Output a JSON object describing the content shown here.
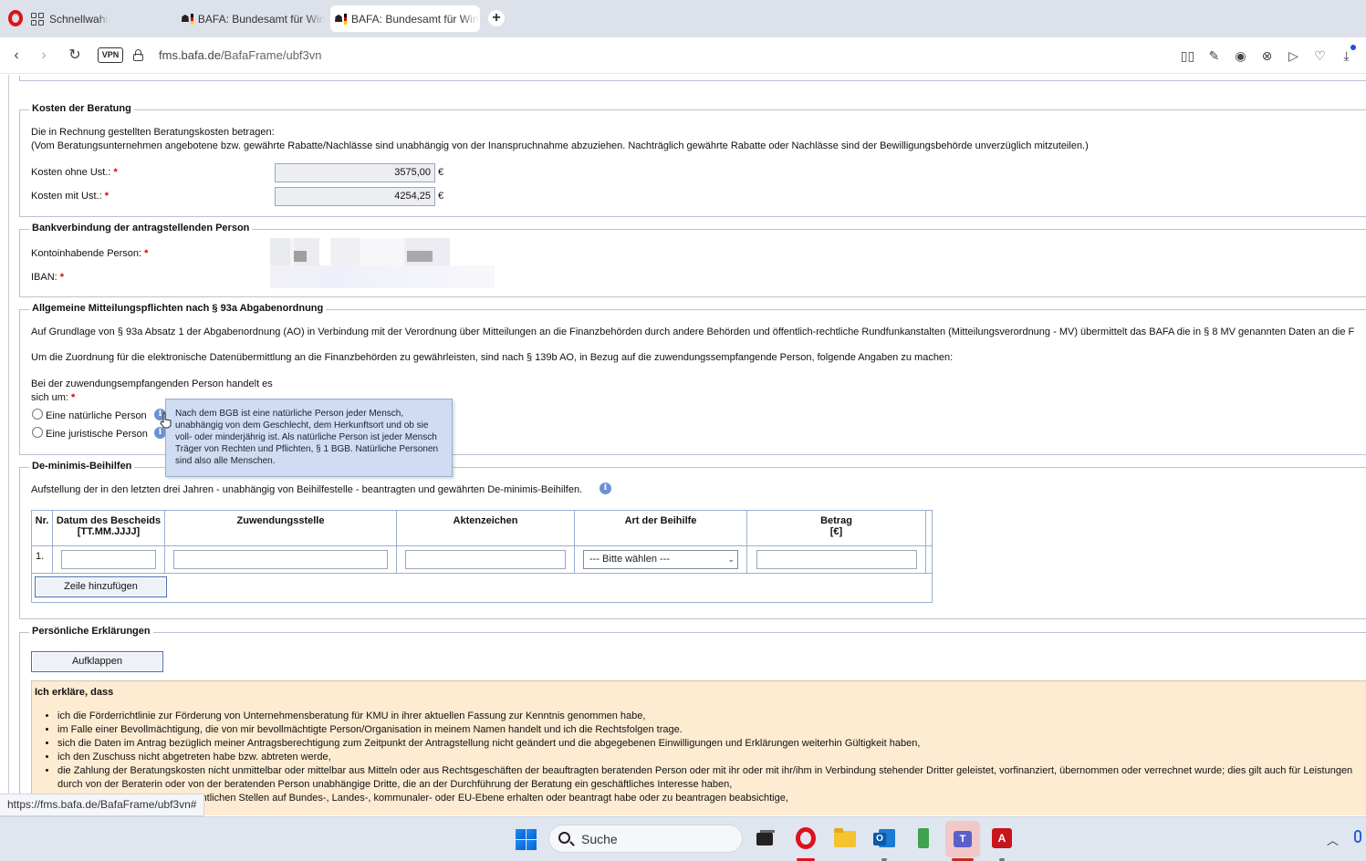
{
  "browser": {
    "tabs": [
      {
        "label": "Schnellwahl",
        "icon": "grid-icon"
      },
      {
        "label": "BAFA: Bundesamt für Wirt",
        "icon": "bafa-flag-icon"
      },
      {
        "label": "BAFA: Bundesamt für Wirt",
        "icon": "bafa-flag-icon",
        "active": true
      }
    ],
    "new_tab": "+",
    "vpn": "VPN",
    "url_host": "fms.bafa.de",
    "url_path": "/BafaFrame/ubf3vn"
  },
  "kosten": {
    "legend": "Kosten der Beratung",
    "intro1": "Die in Rechnung gestellten Beratungskosten betragen:",
    "intro2": "(Vom Beratungsunternehmen angebotene bzw. gewährte Rabatte/Nachlässe sind unabhängig von der Inanspruchnahme abzuziehen. Nachträglich gewährte Rabatte oder Nachlässe sind der Bewilligungsbehörde unverzüglich mitzuteilen.)",
    "ohne_label": "Kosten ohne Ust.:",
    "ohne_value": "3575,00",
    "mit_label": "Kosten mit Ust.:",
    "mit_value": "4254,25",
    "currency": "€",
    "required": "*"
  },
  "bank": {
    "legend": "Bankverbindung der antragstellenden Person",
    "holder_label": "Kontoinhabende Person:",
    "iban_label": "IBAN:"
  },
  "mitteilung": {
    "legend": "Allgemeine Mitteilungspflichten nach § 93a Abgabenordnung",
    "p1": "Auf Grundlage von § 93a Absatz 1 der Abgabenordnung (AO) in Verbindung mit der Verordnung über Mitteilungen an die Finanzbehörden durch andere Behörden und öffentlich-rechtliche Rundfunkanstalten (Mitteilungsverordnung - MV) übermittelt das BAFA die in § 8 MV genannten Daten an die F",
    "p2": "Um die Zuordnung für die elektronische Datenübermittlung an die Finanzbehörden zu gewährleisten, sind nach § 139b AO, in Bezug auf die zuwendungssempfangende Person, folgende Angaben zu machen:",
    "q1": "Bei der zuwendungsempfangenden Person handelt es",
    "q2": "sich um:",
    "opt_natural": "Eine natürliche Person",
    "opt_legal": "Eine juristische Person",
    "info": "i",
    "tooltip": [
      "Nach dem BGB ist eine natürliche Person jeder Mensch,",
      "unabhängig von dem Geschlecht, dem Herkunftsort und ob sie",
      "voll- oder minderjährig ist. Als natürliche Person ist jeder Mensch",
      "Träger von Rechten und Pflichten, § 1 BGB. Natürliche Personen",
      "sind also alle Menschen."
    ]
  },
  "deminimis": {
    "legend": "De-minimis-Beihilfen",
    "intro": "Aufstellung der in den letzten drei Jahren - unabhängig von Beihilfestelle - beantragten und gewährten De-minimis-Beihilfen.",
    "headers": {
      "nr": "Nr.",
      "datum1": "Datum des Bescheids",
      "datum2": "[TT.MM.JJJJ]",
      "stelle": "Zuwendungsstelle",
      "akten": "Aktenzeichen",
      "art": "Art der Beihilfe",
      "betrag1": "Betrag",
      "betrag2": "[€]"
    },
    "row_nr": "1.",
    "select_value": "--- Bitte wählen ---",
    "add_row": "Zeile hinzufügen"
  },
  "erklaerung": {
    "legend": "Persönliche Erklärungen",
    "toggle": "Aufklappen",
    "head": "Ich erkläre, dass",
    "items": [
      "ich die Förderrichtlinie zur Förderung von Unternehmensberatung für KMU in ihrer aktuellen Fassung zur Kenntnis genommen habe,",
      "im Falle einer Bevollmächtigung, die von mir bevollmächtigte Person/Organisation in meinem Namen handelt und ich die Rechtsfolgen trage.",
      "sich die Daten im Antrag bezüglich meiner Antragsberechtigung zum Zeitpunkt der Antragstellung nicht geändert und die abgegebenen Einwilligungen und Erklärungen weiterhin Gültigkeit haben,",
      "ich den Zuschuss nicht abgetreten habe bzw. abtreten werde,",
      "die Zahlung der Beratungskosten nicht unmittelbar oder mittelbar aus Mitteln oder aus Rechtsgeschäften der beauftragten beratenden Person oder mit ihr oder mit ihr/ihm in Verbindung stehender Dritter geleistet, vorfinanziert, übernommen oder verrechnet wurde; dies gilt auch für Leistungen durch von der Beraterin oder von der beratenden Person unabhängige Dritte, die an der Durchführung der Beratung ein geschäftliches Interesse haben,",
      "teren Zuschuss bei anderen öffentlichen Stellen auf Bundes-, Landes-, kommunaler- oder EU-Ebene erhalten oder beantragt habe oder zu beantragen beabsichtige,"
    ]
  },
  "status_url": "https://fms.bafa.de/BafaFrame/ubf3vn#",
  "taskbar": {
    "search_label": "Suche"
  }
}
